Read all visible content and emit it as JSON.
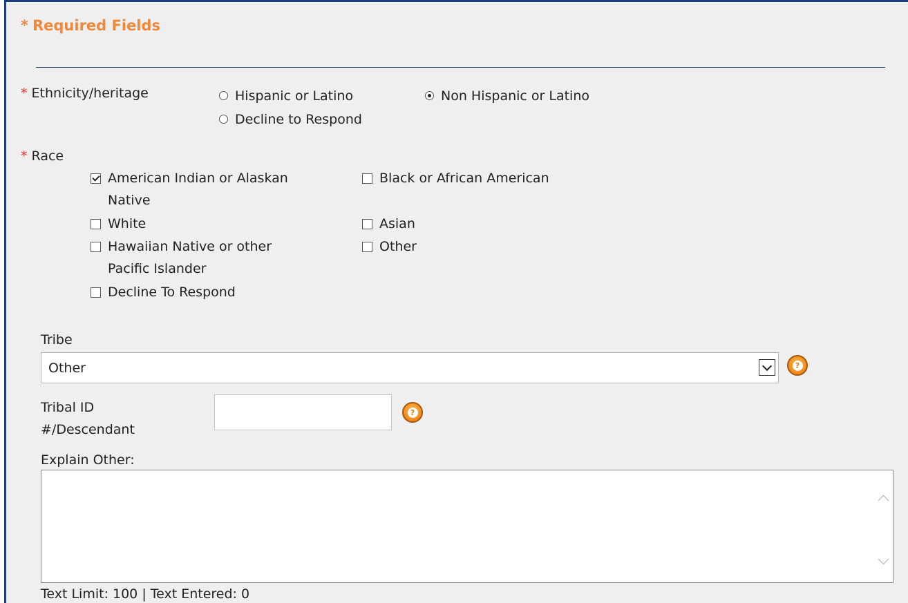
{
  "header": {
    "required_star": "*",
    "required_label": "Required Fields"
  },
  "ethnicity": {
    "star": "*",
    "label": "Ethnicity/heritage",
    "options": [
      {
        "label": "Hispanic or Latino",
        "selected": false
      },
      {
        "label": "Non Hispanic or Latino",
        "selected": true
      },
      {
        "label": "Decline to Respond",
        "selected": false
      }
    ]
  },
  "race": {
    "star": "*",
    "label": "Race",
    "options": [
      {
        "label": "American Indian or Alaskan",
        "label2": "Native",
        "checked": true
      },
      {
        "label": "Black or African American",
        "checked": false
      },
      {
        "label": "White",
        "checked": false
      },
      {
        "label": "Asian",
        "checked": false
      },
      {
        "label": "Hawaiian Native or other",
        "label2": "Pacific Islander",
        "checked": false
      },
      {
        "label": "Other",
        "checked": false
      },
      {
        "label": "Decline To Respond",
        "checked": false
      }
    ]
  },
  "tribe": {
    "label": "Tribe",
    "selected": "Other"
  },
  "tribal_id": {
    "label_line1": "Tribal ID",
    "label_line2": "#/Descendant",
    "value": ""
  },
  "explain": {
    "label": "Explain Other:",
    "value": ""
  },
  "footer": {
    "text_limit": "Text Limit: 100 | Text Entered: 0"
  },
  "colors": {
    "accent": "#f0883a",
    "required_star": "#d9352a",
    "border": "#1f3f7a",
    "panel_bg": "#f0eff0"
  }
}
